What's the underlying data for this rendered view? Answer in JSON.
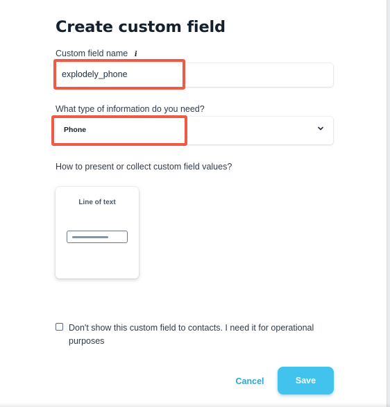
{
  "dialog": {
    "title": "Create custom field"
  },
  "custom_field_name": {
    "label": "Custom field name",
    "info_icon": "info-icon",
    "value": "explodely_phone"
  },
  "info_type": {
    "label": "What type of information do you need?",
    "selected": "Phone",
    "icon": "chevron-down-icon"
  },
  "presentation": {
    "label": "How to present or collect custom field values?",
    "options": [
      {
        "label": "Line of text"
      }
    ]
  },
  "hide_from_contacts": {
    "label": "Don't show this custom field to contacts. I need it for operational purposes",
    "checked": false
  },
  "actions": {
    "cancel_label": "Cancel",
    "save_label": "Save"
  },
  "colors": {
    "accent": "#41c3ee",
    "link": "#2aa7d6",
    "highlight": "#ef5a47"
  }
}
